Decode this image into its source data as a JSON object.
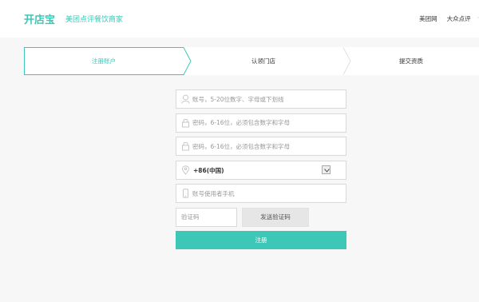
{
  "header": {
    "logo": "开店宝",
    "slogan": "美团点评餐饮商家",
    "links": [
      "美团网",
      "大众点评"
    ]
  },
  "steps": [
    {
      "label": "注册账户",
      "active": true
    },
    {
      "label": "认领门店",
      "active": false
    },
    {
      "label": "提交资质",
      "active": false
    }
  ],
  "form": {
    "account_placeholder": "账号，5-20位数字、字母或下划线",
    "password_placeholder": "密码，6-16位，必须包含数字和字母",
    "confirm_placeholder": "密码，6-16位，必须包含数字和字母",
    "country_code": "+86(中国)",
    "phone_placeholder": "账号使用者手机",
    "code_placeholder": "验证码",
    "send_code_label": "发送验证码",
    "submit_label": "注册"
  },
  "colors": {
    "accent": "#3cc7b6"
  }
}
